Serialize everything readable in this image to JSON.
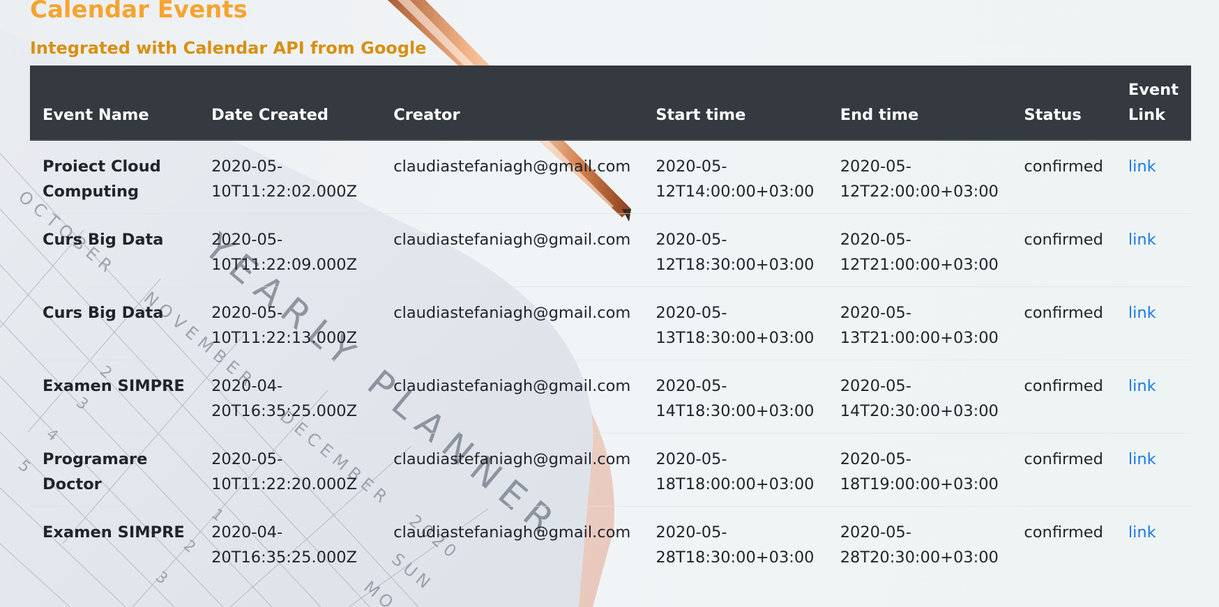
{
  "page": {
    "title": "Calendar Events",
    "subtitle": "Integrated with Calendar API from Google"
  },
  "colors": {
    "title": "#f5a431",
    "subtitle": "#d88f0f",
    "table_header_bg": "#343a40",
    "link": "#1a7ae6"
  },
  "table": {
    "headers": {
      "name": "Event Name",
      "date_created": "Date Created",
      "creator": "Creator",
      "start": "Start time",
      "end": "End time",
      "status": "Status",
      "link": "Event Link"
    },
    "rows": [
      {
        "name": "Proiect Cloud Computing",
        "date_created": "2020-05-10T11:22:02.000Z",
        "creator": "claudiastefaniagh@gmail.com",
        "start": "2020-05-12T14:00:00+03:00",
        "end": "2020-05-12T22:00:00+03:00",
        "status": "confirmed",
        "link": "link"
      },
      {
        "name": "Curs Big Data",
        "date_created": "2020-05-10T11:22:09.000Z",
        "creator": "claudiastefaniagh@gmail.com",
        "start": "2020-05-12T18:30:00+03:00",
        "end": "2020-05-12T21:00:00+03:00",
        "status": "confirmed",
        "link": "link"
      },
      {
        "name": "Curs Big Data",
        "date_created": "2020-05-10T11:22:13.000Z",
        "creator": "claudiastefaniagh@gmail.com",
        "start": "2020-05-13T18:30:00+03:00",
        "end": "2020-05-13T21:00:00+03:00",
        "status": "confirmed",
        "link": "link"
      },
      {
        "name": "Examen SIMPRE",
        "date_created": "2020-04-20T16:35:25.000Z",
        "creator": "claudiastefaniagh@gmail.com",
        "start": "2020-05-14T18:30:00+03:00",
        "end": "2020-05-14T20:30:00+03:00",
        "status": "confirmed",
        "link": "link"
      },
      {
        "name": "Programare Doctor",
        "date_created": "2020-05-10T11:22:20.000Z",
        "creator": "claudiastefaniagh@gmail.com",
        "start": "2020-05-18T18:00:00+03:00",
        "end": "2020-05-18T19:00:00+03:00",
        "status": "confirmed",
        "link": "link"
      },
      {
        "name": "Examen SIMPRE",
        "date_created": "2020-04-20T16:35:25.000Z",
        "creator": "claudiastefaniagh@gmail.com",
        "start": "2020-05-28T18:30:00+03:00",
        "end": "2020-05-28T20:30:00+03:00",
        "status": "confirmed",
        "link": "link"
      }
    ]
  },
  "background": {
    "notebook_text": "YEARLY PLANNER",
    "month_labels": [
      "OCTOBER",
      "NOVEMBER",
      "DECEMBER"
    ],
    "year_label": "2020",
    "day_labels": [
      "SUN",
      "MO"
    ],
    "numbers": [
      "2",
      "3",
      "4",
      "5",
      "1",
      "2",
      "3"
    ]
  }
}
